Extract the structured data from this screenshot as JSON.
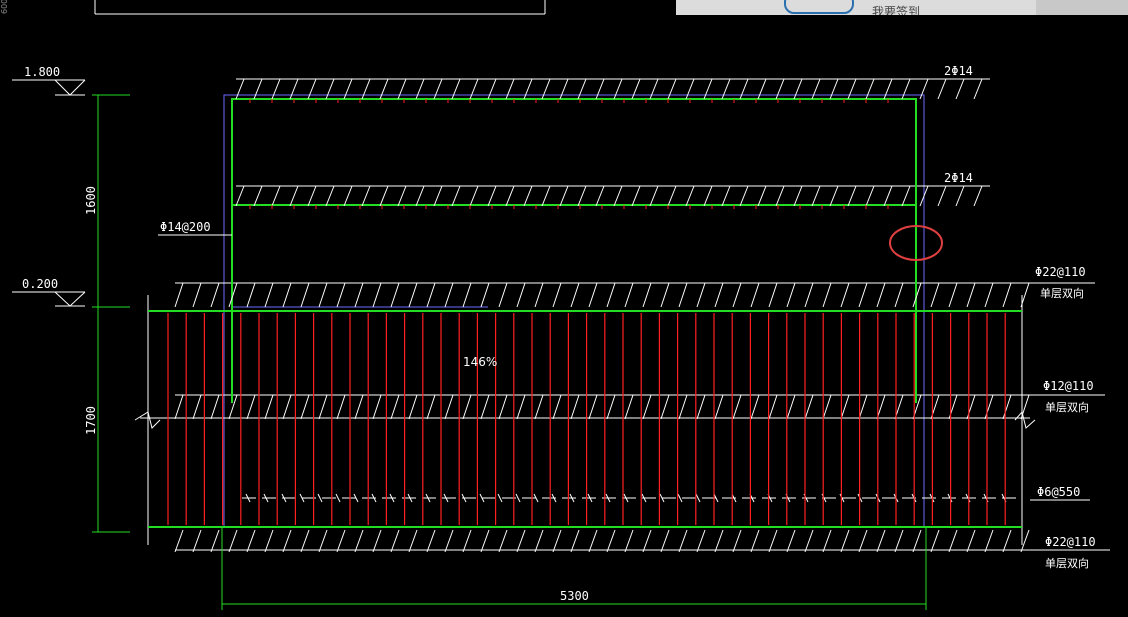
{
  "drawing": {
    "levels": {
      "top": "1.800",
      "mid": "0.200"
    },
    "dimensions": {
      "upper_height": "1600",
      "lower_height": "1700",
      "width": "5300"
    },
    "rebar_labels": {
      "top_bar": "2Φ14",
      "middle_bar": "2Φ14",
      "stirrup": "Φ14@200",
      "slab_top": "Φ22@110",
      "slab_top_note": "单层双向",
      "slab_mid": "Φ12@110",
      "slab_mid_note": "单层双向",
      "tie": "Φ6@550",
      "slab_bottom": "Φ22@110",
      "slab_bottom_note": "单层双向"
    },
    "markup": {
      "circle_color": "#e04040"
    }
  },
  "zoom": "146%",
  "top_panel": {
    "text": "我要签到"
  },
  "corner_text": "600",
  "colors": {
    "line_white": "#ffffff",
    "rebar_red": "#ff2020",
    "rebar_green": "#22dd22",
    "outline_blue": "#6a6aff"
  }
}
